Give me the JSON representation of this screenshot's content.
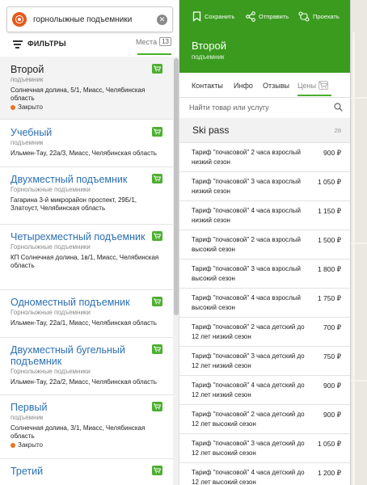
{
  "search": {
    "query": "горнолыжные подъемники",
    "clear_icon": "close-icon"
  },
  "filters": {
    "label": "ФИЛЬТРЫ",
    "places_label": "Места",
    "places_count": "13"
  },
  "list": [
    {
      "title": "Второй",
      "category": "подъемник",
      "address": "Солнечная долина, 5/1, Миасс, Челябинская область",
      "status": "Закрыто"
    },
    {
      "title": "Учебный",
      "category": "подъемник",
      "address": "Ильмен-Тау, 22а/3, Миасс, Челябинская область",
      "status": ""
    },
    {
      "title": "Двухместный подъемник",
      "category": "Горнолыжные подъемники",
      "address": "Гагарина 3-й микрорайон проспект, 29Б/1, Златоуст, Челябинская область",
      "status": ""
    },
    {
      "title": "Четырехместный подъемник",
      "category": "Горнолыжные подъемники",
      "address": "КП Солнечная долина, 1в/1, Миасс, Челябинская область",
      "status": ""
    },
    {
      "title": "Одноместный подъемник",
      "category": "Горнолыжные подъемники",
      "address": "Ильмен-Тау, 22а/1, Миасс, Челябинская область",
      "status": ""
    },
    {
      "title": "Двухместный бугельный подъемник",
      "category": "Горнолыжные подъемники",
      "address": "Ильмен-Тау, 22а/2, Миасс, Челябинская область",
      "status": ""
    },
    {
      "title": "Первый",
      "category": "подъемник",
      "address": "Солнечная долина, 3/1, Миасс, Челябинская область",
      "status": "Закрыто"
    },
    {
      "title": "Третий",
      "category": "",
      "address": "",
      "status": ""
    }
  ],
  "header": {
    "actions": [
      "Сохранить",
      "Отправить",
      "Проехать"
    ],
    "name": "Второй",
    "subtitle": "подъемник"
  },
  "tabs": [
    "Контакты",
    "Инфо",
    "Отзывы",
    "Цены"
  ],
  "price_search": {
    "placeholder": "Найти товар или услугу"
  },
  "section": {
    "title": "Ski pass",
    "count": "28"
  },
  "prices": [
    {
      "name": "Тариф \"почасовой\" 2 часа взрослый низкий сезон",
      "value": "900 ₽"
    },
    {
      "name": "Тариф \"почасовой\" 3 часа взрослый низкий сезон",
      "value": "1 050 ₽"
    },
    {
      "name": "Тариф \"почасовой\" 4 часа взрослый низкий сезон",
      "value": "1 150 ₽"
    },
    {
      "name": "Тариф \"почасовой\" 2 часа взрослый высокий сезон",
      "value": "1 500 ₽"
    },
    {
      "name": "Тариф \"почасовой\" 3 часа взрослый высокий сезон",
      "value": "1 800 ₽"
    },
    {
      "name": "Тариф \"почасовой\" 4 часа взрослый высокий сезон",
      "value": "1 750 ₽"
    },
    {
      "name": "Тариф \"почасовой\" 2 часа детский до 12 лет низкий сезон",
      "value": "700 ₽"
    },
    {
      "name": "Тариф \"почасовой\" 3 часа детский до 12 лет низкий сезон",
      "value": "750 ₽"
    },
    {
      "name": "Тариф \"почасовой\" 4 часа детский до 12 лет низкий сезон",
      "value": "900 ₽"
    },
    {
      "name": "Тариф \"почасовой\" 2 часа детский до 12 лет высокий сезон",
      "value": "900 ₽"
    },
    {
      "name": "Тариф \"почасовой\" 3 часа детский до 12 лет высокий сезон",
      "value": "1 050 ₽"
    },
    {
      "name": "Тариф \"почасовой\" 4 часа детский до 12 лет высокий сезон",
      "value": "1 200 ₽"
    }
  ],
  "colors": {
    "brand_green": "#3a9b1e",
    "accent_green": "#4caf2f",
    "link_blue": "#2b6fb3",
    "closed_orange": "#e8741c"
  }
}
